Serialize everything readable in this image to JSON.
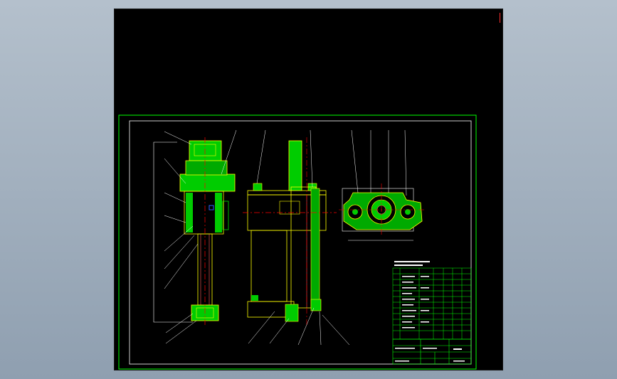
{
  "colors": {
    "background": "#000000",
    "frame": "#00ff00",
    "inner_frame": "#ffffff",
    "hatch_fill": "#00cc00",
    "centerline": "#ff0000",
    "outline": "#ffff00",
    "leader": "#ffffff"
  },
  "drawing": {
    "views": [
      "front-section-view",
      "side-view",
      "top-view"
    ],
    "title_block_rows": 4,
    "parts_list_rows": 12
  }
}
